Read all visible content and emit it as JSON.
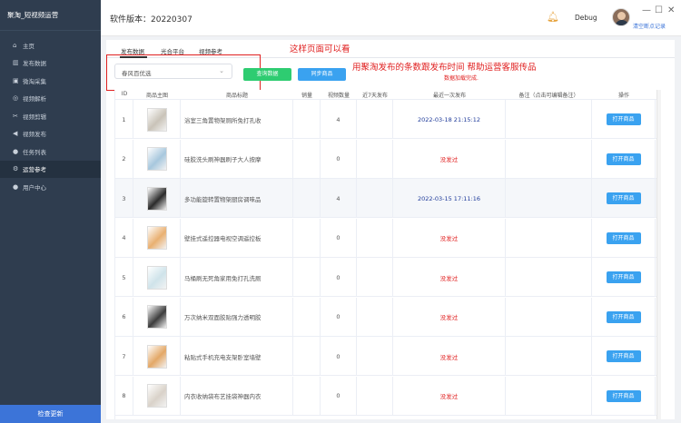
{
  "sidebar": {
    "title": "聚淘_短视频运营",
    "items": [
      {
        "label": "主页",
        "icon": "home-icon",
        "glyph": "⌂"
      },
      {
        "label": "发布数据",
        "icon": "bar-chart-icon",
        "glyph": "▥"
      },
      {
        "label": "微淘采集",
        "icon": "collect-icon",
        "glyph": "▣"
      },
      {
        "label": "视频解析",
        "icon": "video-parse-icon",
        "glyph": "◎"
      },
      {
        "label": "视频剪辑",
        "icon": "scissors-icon",
        "glyph": "✂"
      },
      {
        "label": "视频发布",
        "icon": "send-icon",
        "glyph": "◀"
      },
      {
        "label": "任务列表",
        "icon": "user-icon",
        "glyph": "●"
      },
      {
        "label": "运营参考",
        "icon": "gear-icon",
        "glyph": "⚙"
      },
      {
        "label": "用户中心",
        "icon": "user-center-icon",
        "glyph": "●"
      }
    ],
    "active_index": 7,
    "bottom_button": "检查更新"
  },
  "header": {
    "version": "软件版本：20220307",
    "debug": "Debug",
    "clear_link": "清空断点记录",
    "minimize": "—",
    "maximize": "☐",
    "close": "✕"
  },
  "tabs": [
    {
      "label": "发布数据",
      "active": true
    },
    {
      "label": "光合平台",
      "active": false
    },
    {
      "label": "视频参考",
      "active": false
    }
  ],
  "annotations": {
    "a1": "这样页面可以看",
    "a2": "用聚淘发布的条数跟发布时间  帮助运营客服传品",
    "a3": "数据加载完成."
  },
  "filter": {
    "select_value": "春风百优选",
    "query_button": "查询数据",
    "sync_button": "同步商品"
  },
  "table": {
    "headers": [
      "ID",
      "商品主图",
      "商品标题",
      "销量",
      "视频数量",
      "近7天发布",
      "最近一次发布",
      "备注（点击可编辑备注）",
      "操作"
    ],
    "rows": [
      {
        "id": "1",
        "title": "浴室三角置物架厕所免打孔收",
        "sales": "",
        "video_count": "4",
        "week": "",
        "last": "2022-03-18 21:15:12",
        "has_date": true,
        "remark": "",
        "action": "打开商品",
        "thumb": "#c9c3b8"
      },
      {
        "id": "2",
        "title": "硅胶洗头刷神器刷子大人按摩",
        "sales": "",
        "video_count": "0",
        "week": "",
        "last": "没发过",
        "has_date": false,
        "remark": "",
        "action": "打开商品",
        "thumb": "#a7c7dd"
      },
      {
        "id": "3",
        "title": "多功能旋转置物架厨房调味品",
        "sales": "",
        "video_count": "4",
        "week": "",
        "last": "2022-03-15 17:11:16",
        "has_date": true,
        "remark": "",
        "action": "打开商品",
        "thumb": "#2b2b2b"
      },
      {
        "id": "4",
        "title": "壁挂式遥控器电视空调遥控板",
        "sales": "",
        "video_count": "0",
        "week": "",
        "last": "没发过",
        "has_date": false,
        "remark": "",
        "action": "打开商品",
        "thumb": "#e9b071"
      },
      {
        "id": "5",
        "title": "马桶刷无死角家用免打孔洗厕",
        "sales": "",
        "video_count": "0",
        "week": "",
        "last": "没发过",
        "has_date": false,
        "remark": "",
        "action": "打开商品",
        "thumb": "#cfe3ea"
      },
      {
        "id": "6",
        "title": "万次纳米双面胶贴强力透明胶",
        "sales": "",
        "video_count": "0",
        "week": "",
        "last": "没发过",
        "has_date": false,
        "remark": "",
        "action": "打开商品",
        "thumb": "#3c3c3c"
      },
      {
        "id": "7",
        "title": "粘贴式手机充电支架卧室墙壁",
        "sales": "",
        "video_count": "0",
        "week": "",
        "last": "没发过",
        "has_date": false,
        "remark": "",
        "action": "打开商品",
        "thumb": "#e3a867"
      },
      {
        "id": "8",
        "title": "内衣收纳袋布艺挂袋神器内衣",
        "sales": "",
        "video_count": "0",
        "week": "",
        "last": "没发过",
        "has_date": false,
        "remark": "",
        "action": "打开商品",
        "thumb": "#d9d2c9"
      }
    ]
  },
  "colors": {
    "sidebar_bg": "#2f3d4f",
    "accent_blue": "#3aa2f0",
    "green": "#2ecc71",
    "annotation_red": "#e02020",
    "date_blue": "#1e3a9a"
  }
}
